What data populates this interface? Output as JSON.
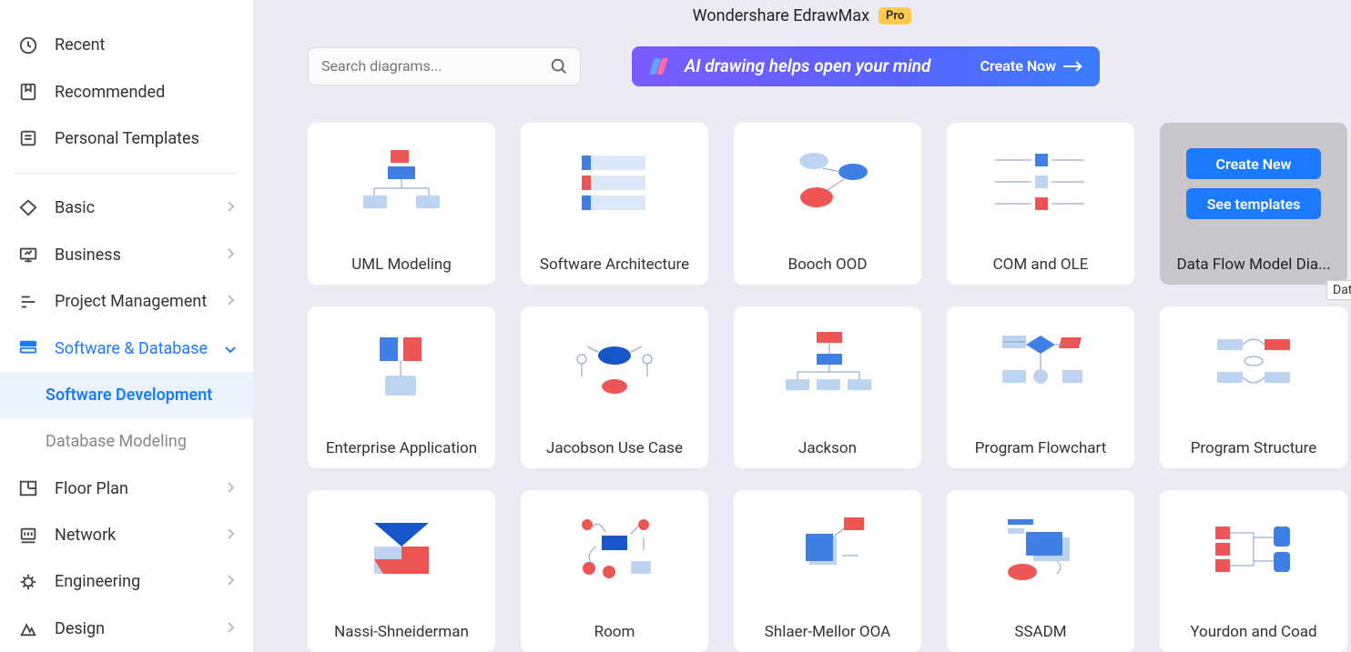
{
  "header": {
    "title": "Wondershare EdrawMax",
    "badge": "Pro"
  },
  "search": {
    "placeholder": "Search diagrams..."
  },
  "ai_banner": {
    "text": "AI drawing helps open your mind",
    "button": "Create Now"
  },
  "sidebar": {
    "top": [
      {
        "label": "Recent",
        "icon": "clock"
      },
      {
        "label": "Recommended",
        "icon": "bookmark"
      },
      {
        "label": "Personal Templates",
        "icon": "templates"
      }
    ],
    "categories": [
      {
        "label": "Basic",
        "icon": "tag"
      },
      {
        "label": "Business",
        "icon": "presentation"
      },
      {
        "label": "Project Management",
        "icon": "gantt"
      },
      {
        "label": "Software & Database",
        "icon": "database",
        "active": true
      },
      {
        "label": "Floor Plan",
        "icon": "floorplan"
      },
      {
        "label": "Network",
        "icon": "network"
      },
      {
        "label": "Engineering",
        "icon": "gear"
      },
      {
        "label": "Design",
        "icon": "design"
      }
    ],
    "sub": {
      "selected": "Software Development",
      "other": "Database Modeling"
    }
  },
  "templates": [
    {
      "label": "UML Modeling",
      "thumb": "uml"
    },
    {
      "label": "Software Architecture",
      "thumb": "arch"
    },
    {
      "label": "Booch OOD",
      "thumb": "booch"
    },
    {
      "label": "COM and OLE",
      "thumb": "com"
    },
    {
      "label": "Data Flow Model Dia...",
      "thumb": "dfd",
      "hovered": true
    },
    {
      "label": "Enterprise Application",
      "thumb": "ea"
    },
    {
      "label": "Jacobson Use Case",
      "thumb": "jacobson"
    },
    {
      "label": "Jackson",
      "thumb": "jackson"
    },
    {
      "label": "Program Flowchart",
      "thumb": "flowchart"
    },
    {
      "label": "Program Structure",
      "thumb": "structure"
    },
    {
      "label": "Nassi-Shneiderman",
      "thumb": "nassi"
    },
    {
      "label": "Room",
      "thumb": "room"
    },
    {
      "label": "Shlaer-Mellor OOA",
      "thumb": "shlaer"
    },
    {
      "label": "SSADM",
      "thumb": "ssadm"
    },
    {
      "label": "Yourdon and Coad",
      "thumb": "yourdon"
    }
  ],
  "hover_actions": {
    "create": "Create New",
    "see": "See templates"
  },
  "tooltip": "Dat"
}
